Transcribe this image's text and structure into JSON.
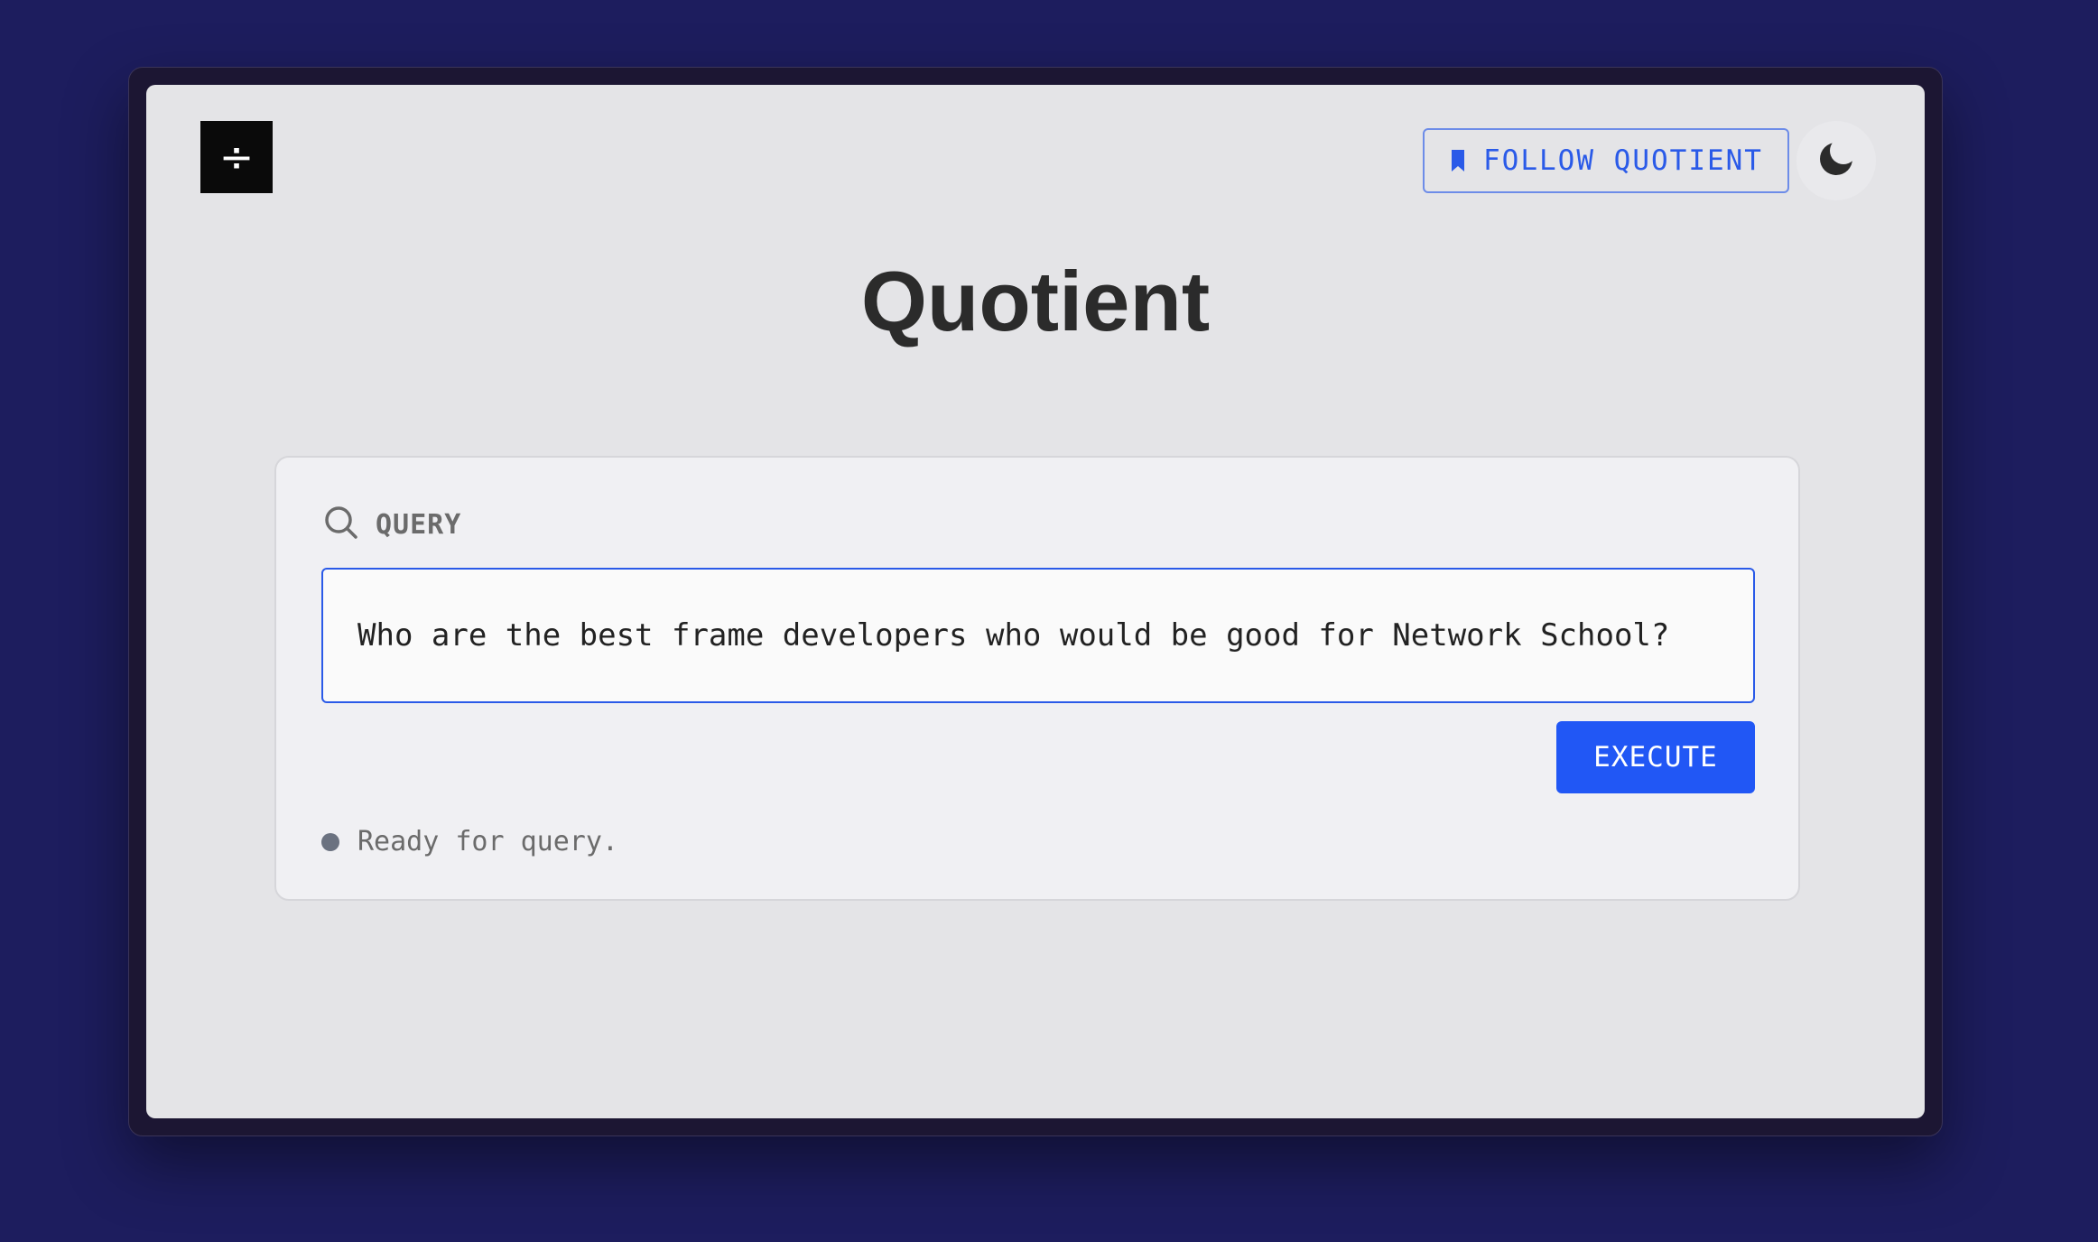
{
  "app": {
    "title": "Quotient",
    "logo_glyph": "÷"
  },
  "header": {
    "follow_label": "FOLLOW QUOTIENT",
    "follow_icon": "bookmark-icon",
    "theme_icon": "moon-icon"
  },
  "query": {
    "section_label": "QUERY",
    "section_icon": "search-icon",
    "input_value": "Who are the best frame developers who would be good for Network School?",
    "execute_label": "EXECUTE",
    "status_text": "Ready for query."
  },
  "colors": {
    "accent": "#2157f5",
    "page_background": "#1d1d5e",
    "screen_background": "#e4e4e7",
    "title_text": "#2b2b2b",
    "status_dot": "#6b7280"
  }
}
